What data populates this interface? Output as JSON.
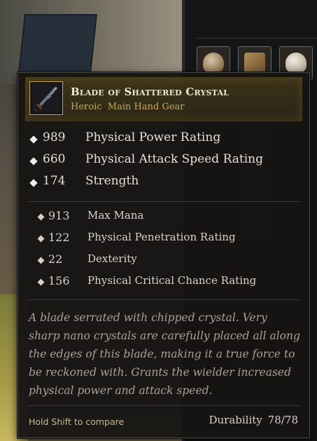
{
  "tooltip": {
    "item_name": "Blade of Shattered Crystal",
    "item_subtitle": "Heroic  Main Hand Gear",
    "icon": "blade-icon",
    "main_stats": [
      {
        "value": "989",
        "name": "Physical Power Rating"
      },
      {
        "value": "660",
        "name": "Physical Attack Speed Rating"
      },
      {
        "value": "174",
        "name": "Strength"
      }
    ],
    "secondary_stats": [
      {
        "value": "913",
        "name": "Max Mana"
      },
      {
        "value": "122",
        "name": "Physical Penetration Rating"
      },
      {
        "value": "22",
        "name": "Dexterity"
      },
      {
        "value": "156",
        "name": "Physical Critical Chance Rating"
      }
    ],
    "description": "A blade serrated with chipped crystal. Very sharp nano crystals are carefully placed all along the edges of this blade, making it a true force to be reckoned with. Grants the wielder increased physical power and attack speed.",
    "compare_hint": "Hold Shift to compare",
    "durability_label": "Durability",
    "durability_value": "78/78"
  },
  "inventory": {
    "slots": [
      {
        "icon": "bag-icon"
      },
      {
        "icon": "scroll-icon"
      },
      {
        "icon": "pouch-icon"
      }
    ]
  },
  "colors": {
    "item_name": "#eee6d2",
    "rarity_heroic": "#c8a85a",
    "description": "#a8a196",
    "hint": "#c9b98a"
  }
}
